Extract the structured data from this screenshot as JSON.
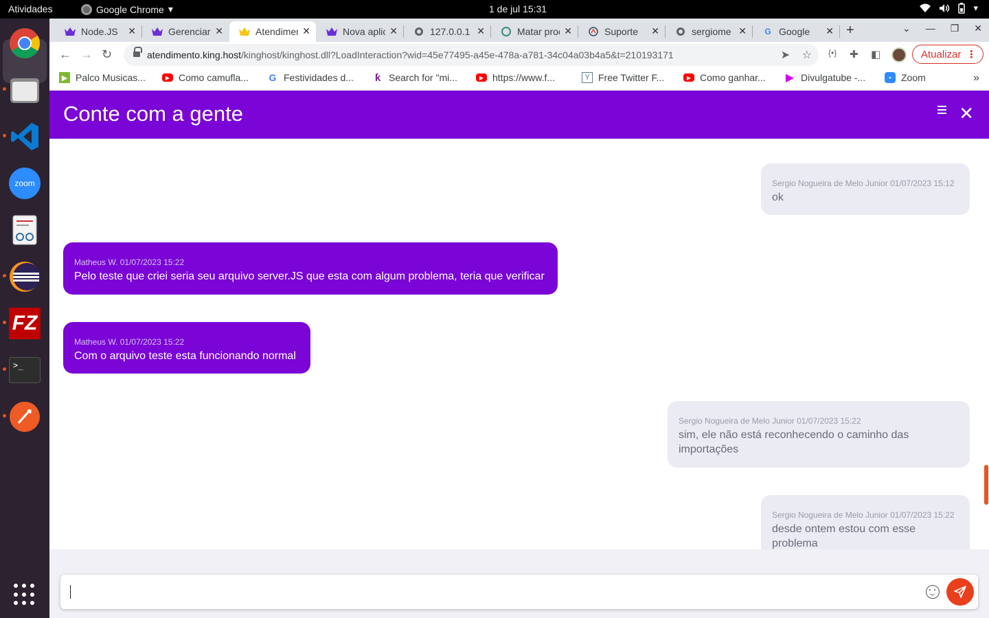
{
  "os": {
    "activities_label": "Atividades",
    "active_app_label": "Google Chrome",
    "clock": "1 de jul  15:31"
  },
  "dock": {
    "items": [
      "chrome",
      "files",
      "vscode",
      "zoom",
      "document-viewer",
      "eclipse",
      "filezilla",
      "terminal",
      "postman"
    ]
  },
  "browser": {
    "tabs": [
      {
        "label": "Node.JS",
        "icon": "kinghost-crown-icon"
      },
      {
        "label": "Gerenciar",
        "icon": "kinghost-crown-icon"
      },
      {
        "label": "Atendimento",
        "icon": "kinghost-crown-yellow-icon",
        "active": true
      },
      {
        "label": "Nova aplicação",
        "icon": "kinghost-crown-icon"
      },
      {
        "label": "127.0.0.1",
        "icon": "globe-icon"
      },
      {
        "label": "Matar processo",
        "icon": "chatgpt-icon"
      },
      {
        "label": "Suporte",
        "icon": "support-icon"
      },
      {
        "label": "sergiome",
        "icon": "globe-icon"
      },
      {
        "label": "Google",
        "icon": "google-icon"
      }
    ],
    "url_host": "atendimento.king.host",
    "url_path": "/kinghost/kinghost.dll?LoadInteraction?wid=45e77495-a45e-478a-a781-34c04a03b4a5&t=210193171",
    "update_label": "Atualizar",
    "bookmarks": [
      {
        "label": "Palco Musicas...",
        "icon": "palco-icon",
        "color": "#7cb82f"
      },
      {
        "label": "Como camufla...",
        "icon": "youtube-icon",
        "color": "#ff0000"
      },
      {
        "label": "Festividades d...",
        "icon": "google-icon",
        "color": "#4285f4"
      },
      {
        "label": "Search for \"mi...",
        "icon": "search-k-icon",
        "color": "#7b1fa2"
      },
      {
        "label": "https://www.f...",
        "icon": "youtube-icon",
        "color": "#ff0000"
      },
      {
        "label": "Free Twitter F...",
        "icon": "y-icon",
        "color": "#607d8b"
      },
      {
        "label": "Como ganhar...",
        "icon": "youtube-icon",
        "color": "#ff0000"
      },
      {
        "label": "Divulgatube -...",
        "icon": "play-icon",
        "color": "#d500f9"
      },
      {
        "label": "Zoom",
        "icon": "zoom-icon",
        "color": "#2d8cff"
      }
    ]
  },
  "chat": {
    "title": "Conte com a gente",
    "accent": "#7a05d6",
    "send_color": "#e8401c",
    "messages": [
      {
        "direction": "out",
        "author": "Sergio Nogueira de Melo Junior",
        "timestamp": "01/07/2023 15:12",
        "text": "ok"
      },
      {
        "direction": "in",
        "author": "Matheus W.",
        "timestamp": "01/07/2023 15:22",
        "text": "Pelo teste que criei seria seu arquivo server.JS que esta com algum problema, teria que verificar"
      },
      {
        "direction": "in",
        "author": "Matheus W.",
        "timestamp": "01/07/2023 15:22",
        "text": "Com o arquivo teste esta funcionando normal"
      },
      {
        "direction": "out",
        "author": "Sergio Nogueira de Melo Junior",
        "timestamp": "01/07/2023 15:22",
        "text": "sim, ele não está reconhecendo o caminho das importações"
      },
      {
        "direction": "out",
        "author": "Sergio Nogueira de Melo Junior",
        "timestamp": "01/07/2023 15:22",
        "text": "desde ontem estou com esse problema"
      }
    ],
    "composer_value": ""
  }
}
